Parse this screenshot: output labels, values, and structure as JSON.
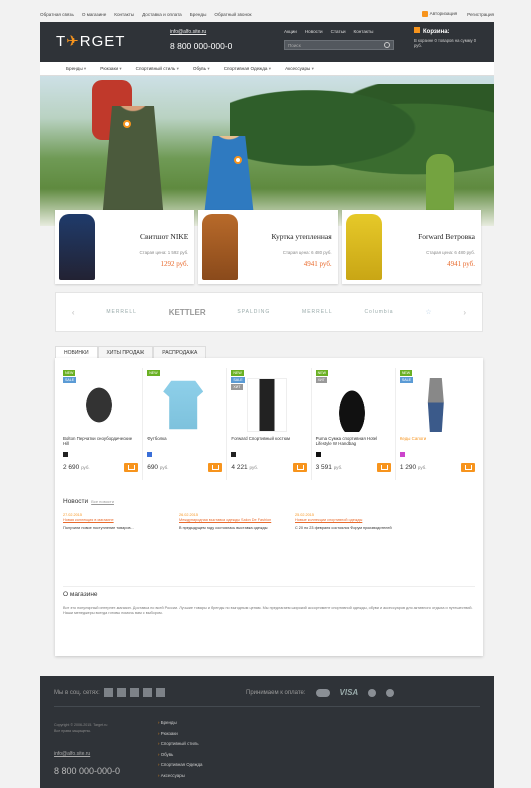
{
  "topbar": {
    "links": [
      "Обратная связь",
      "О магазине",
      "Контакты",
      "Доставка и оплата",
      "Бренды",
      "Обратный звонок"
    ],
    "login": "Авторизация",
    "register": "Регистрация"
  },
  "header": {
    "logo_left": "T",
    "logo_accent": "✈",
    "logo_right": "RGET",
    "email": "info@alfo.site.ru",
    "phone": "8 800 000-000-0",
    "nav": [
      "Акции",
      "Новости",
      "Статьи",
      "Контакты"
    ],
    "search_placeholder": "Поиск",
    "cart_title": "Корзина:",
    "cart_status": "В корзине 0 товаров на сумму 0 руб."
  },
  "menu": [
    "Бренды",
    "Рюкзаки",
    "Спортивный стиль",
    "Обувь",
    "Спортивная Одежда",
    "Аксессуары"
  ],
  "promos": [
    {
      "title": "Свитшот NIKE",
      "old": "Старая цена: 1 592 руб.",
      "new": "1292 руб."
    },
    {
      "title": "Куртка утепленная",
      "old": "Старая цена: 6 480 руб.",
      "new": "4941 руб."
    },
    {
      "title": "Forward Ветровка",
      "old": "Старая цена: 6 480 руб.",
      "new": "4941 руб."
    }
  ],
  "brands": {
    "prev": "‹",
    "next": "›",
    "items": [
      "MERRELL",
      "KETTLER",
      "SPALDING",
      "MERRELL",
      "Columbia",
      "☆"
    ]
  },
  "tabs": [
    "НОВИНКИ",
    "ХИТЫ ПРОДАЖ",
    "РАСПРОДАЖА"
  ],
  "products": [
    {
      "name": "Bolton Перчатки сноубордические Hill",
      "price": "2 690",
      "cur": "руб.",
      "badges": [
        "NEW",
        "SALE"
      ],
      "swatch": "#222222"
    },
    {
      "name": "Футболка",
      "price": "690",
      "cur": "руб.",
      "badges": [
        "NEW"
      ],
      "swatch": "#3a6fd8"
    },
    {
      "name": "Forward Спортивный костюм",
      "price": "4 221",
      "cur": "руб.",
      "badges": [
        "NEW",
        "SALE",
        "ХИТ"
      ],
      "swatch": "#222222"
    },
    {
      "name": "Puma Сумка спортивная Hotel Lifestyle W Handbag",
      "price": "3 591",
      "cur": "руб.",
      "badges": [
        "NEW",
        "ХИТ"
      ],
      "swatch": "#111111"
    },
    {
      "name": "Кеды Сапоги",
      "price": "1 290",
      "cur": "руб.",
      "badges": [
        "NEW",
        "SALE"
      ],
      "swatch": "#cc44cc"
    }
  ],
  "news": {
    "title": "Новости",
    "all": "Все новости",
    "items": [
      {
        "date": "27.02.2015",
        "link": "Новая коллекция в магазине",
        "text": "Получили новое поступление товаров..."
      },
      {
        "date": "26.02.2015",
        "link": "Международная выставка одежды Salon De Fashion",
        "text": "В предыдущем году состоялась выставка одежды"
      },
      {
        "date": "25.02.2015",
        "link": "Новые коллекции спортивной одежды",
        "text": "С 20 по 23 февраля состоялся Форум производителей"
      }
    ]
  },
  "about": {
    "title": "О магазине",
    "text": "Вот это популярный интернет-магазин. Доставка по всей России. Лучшие товары и бренды по выгодным ценам. Мы предлагаем широкий ассортимент спортивной одежды, обуви и аксессуаров для активного отдыха и путешествий. Наши менеджеры всегда готовы помочь вам с выбором."
  },
  "footer": {
    "social_label": "Мы в соц. сетях:",
    "social_icons": [
      "т",
      "ф",
      "в",
      "в",
      "©"
    ],
    "pay_label": "Принимаем к оплате:",
    "visa": "VISA",
    "copyright": "Copyright © 2006-2015. Target.ru",
    "rights": "Все права защищены.",
    "email": "info@alfo.site.ru",
    "phone": "8 800 000-000-0",
    "links": [
      "Бренды",
      "Рюкзаки",
      "Спортивный стиль",
      "Обувь",
      "Спортивная Одежда",
      "Аксессуары"
    ]
  },
  "colors": {
    "accent": "#f7941d",
    "header_bg": "#2f3338",
    "new_badge": "#6ab023",
    "sale_badge": "#5b9bd5"
  }
}
